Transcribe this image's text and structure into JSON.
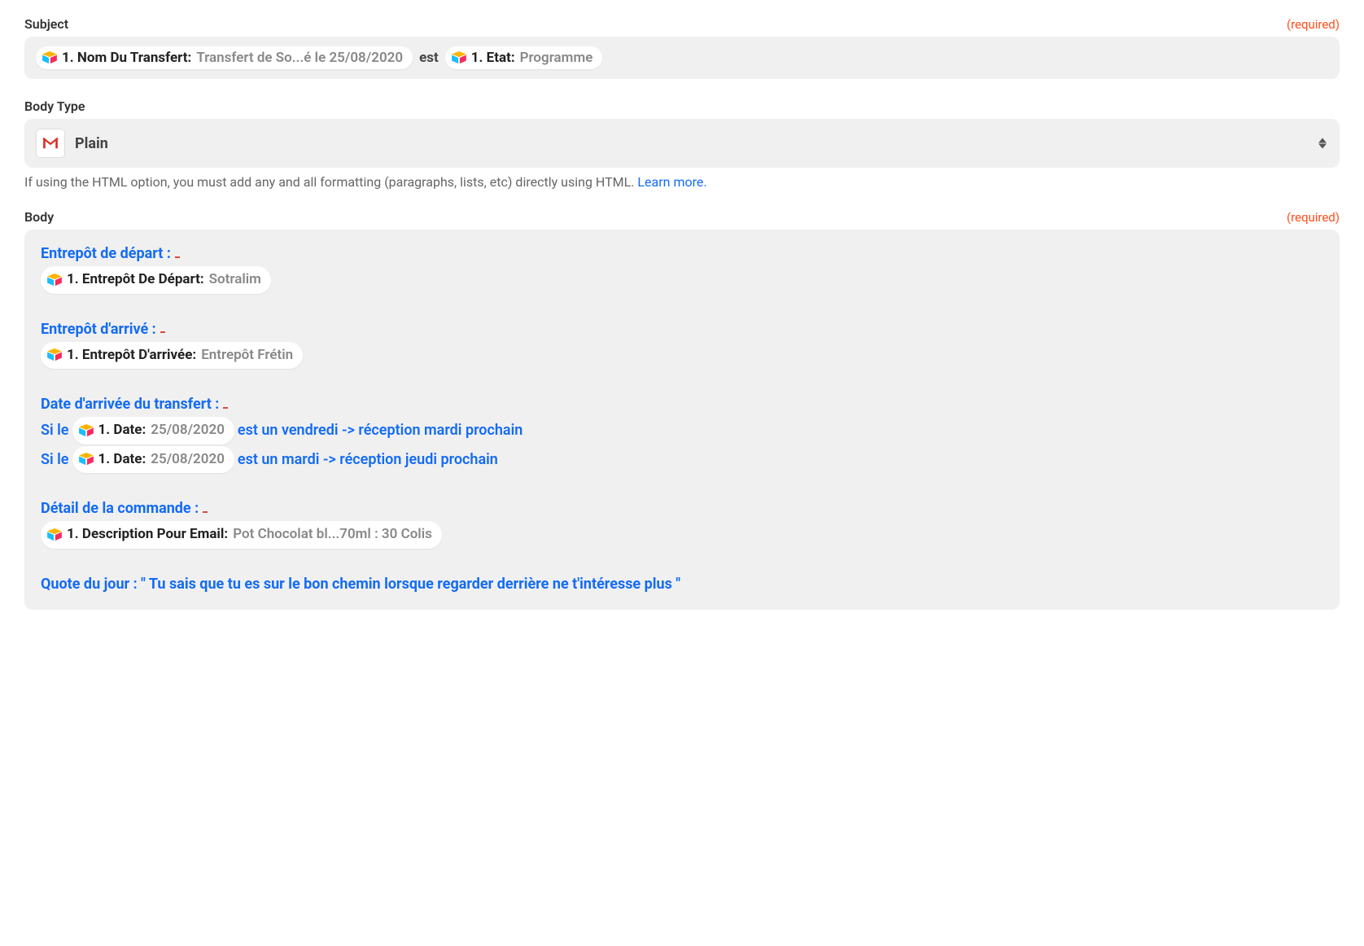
{
  "subject": {
    "label": "Subject",
    "required": "(required)",
    "pill1_label": "1. Nom Du Transfert:",
    "pill1_value": "Transfert de So...é le 25/08/2020",
    "between": "est",
    "pill2_label": "1. Etat:",
    "pill2_value": "Programme"
  },
  "bodyType": {
    "label": "Body Type",
    "value": "Plain",
    "helpText": "If using the HTML option, you must add any and all formatting (paragraphs, lists, etc) directly using HTML. ",
    "helpLink": "Learn more."
  },
  "body": {
    "label": "Body",
    "required": "(required)",
    "heading_depart": "Entrepôt de départ :",
    "pill_depart_label": "1. Entrepôt De Départ:",
    "pill_depart_value": "Sotralim",
    "heading_arrive": "Entrepôt d'arrivé :",
    "pill_arrive_label": "1. Entrepôt D'arrivée:",
    "pill_arrive_value": "Entrepôt Frétin",
    "heading_date": "Date d'arrivée du transfert :",
    "si_le": "Si le",
    "pill_date1_label": "1. Date:",
    "pill_date1_value": "25/08/2020",
    "rule_vendredi": "est un vendredi -> réception mardi prochain",
    "pill_date2_label": "1. Date:",
    "pill_date2_value": "25/08/2020",
    "rule_mardi": "est un mardi -> réception jeudi prochain",
    "heading_detail": "Détail de la commande :",
    "pill_desc_label": "1. Description Pour Email:",
    "pill_desc_value": "Pot Chocolat bl...70ml : 30 Colis",
    "quote": "Quote du jour : \" Tu sais que tu es sur le bon chemin lorsque regarder derrière  ne t'intéresse plus \""
  }
}
